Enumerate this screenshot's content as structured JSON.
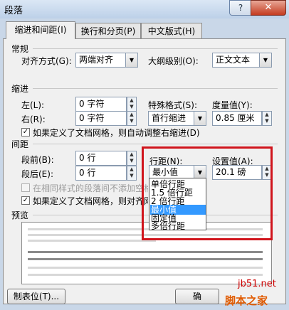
{
  "window": {
    "title": "段落",
    "help": "?",
    "close": "✕"
  },
  "tabs": [
    "缩进和间距(I)",
    "换行和分页(P)",
    "中文版式(H)"
  ],
  "general": {
    "section": "常规",
    "align_label": "对齐方式(G):",
    "align_value": "两端对齐",
    "outline_label": "大纲级别(O):",
    "outline_value": "正文文本"
  },
  "indent": {
    "section": "缩进",
    "left_label": "左(L):",
    "left_value": "0 字符",
    "right_label": "右(R):",
    "right_value": "0 字符",
    "special_label": "特殊格式(S):",
    "special_value": "首行缩进",
    "measure_label": "度量值(Y):",
    "measure_value": "0.85 厘米",
    "grid_check": "如果定义了文档网格，则自动调整右缩进(D)"
  },
  "spacing": {
    "section": "间距",
    "before_label": "段前(B):",
    "before_value": "0 行",
    "after_label": "段后(E):",
    "after_value": "0 行",
    "line_label": "行距(N):",
    "line_value": "最小值",
    "setting_label": "设置值(A):",
    "setting_value": "20.1 磅",
    "same_style_check": "在相同样式的段落间不添加空格",
    "grid_check": "如果定义了文档网格，则对齐网格"
  },
  "line_spacing_options": [
    "单倍行距",
    "1.5 倍行距",
    "2 倍行距",
    "最小值",
    "固定值",
    "多倍行距"
  ],
  "preview": {
    "section": "预览"
  },
  "buttons": {
    "tabs_button": "制表位(T)...",
    "ok_partial": "确"
  },
  "watermark": {
    "site": "jb51.net",
    "name": "脚本之家"
  },
  "colors": {
    "highlight": "#d0141c",
    "selected": "#3399ff"
  }
}
